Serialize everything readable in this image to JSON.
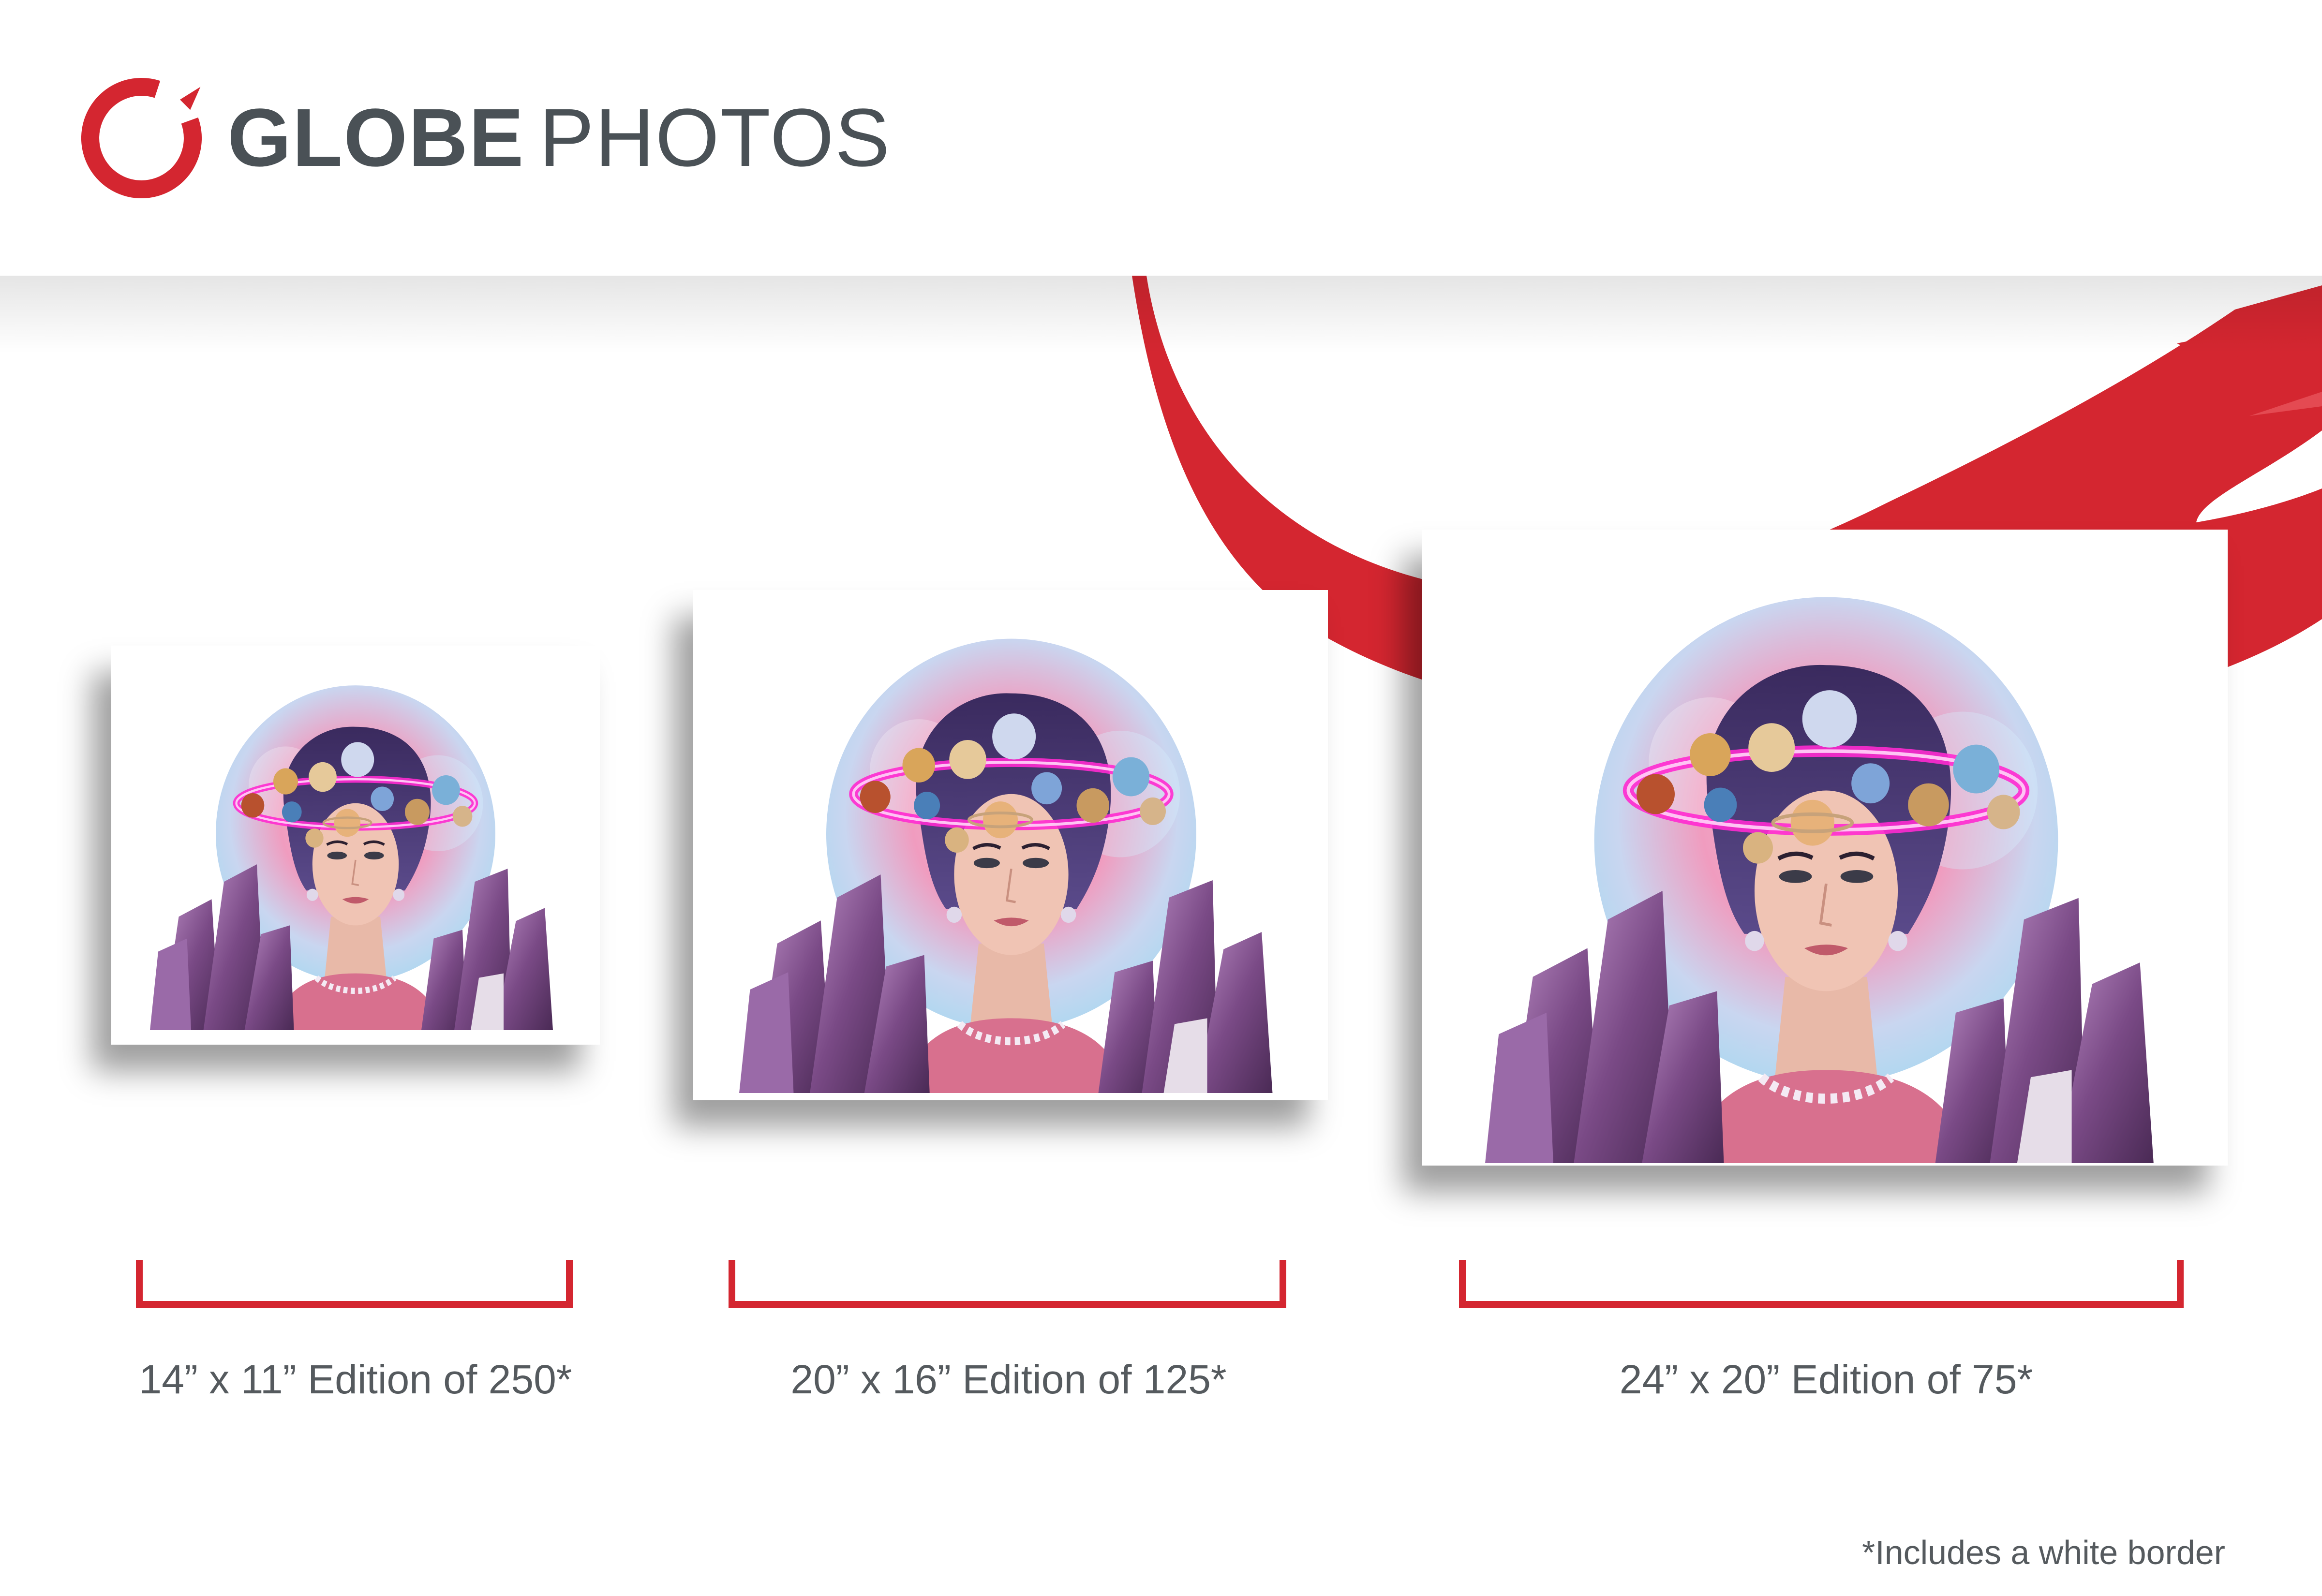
{
  "brand": {
    "name_bold": "GLOBE",
    "name_light": "PHOTOS",
    "accent_color": "#d42630",
    "text_color": "#4a5156"
  },
  "artwork": {
    "icon": "portrait-icon"
  },
  "print_sizes": [
    {
      "label": "14” x 11” Edition of 250*"
    },
    {
      "label": "20” x 16” Edition of 125*"
    },
    {
      "label": "24” x 20” Edition of 75*"
    }
  ],
  "footnote": "*Includes a white border"
}
